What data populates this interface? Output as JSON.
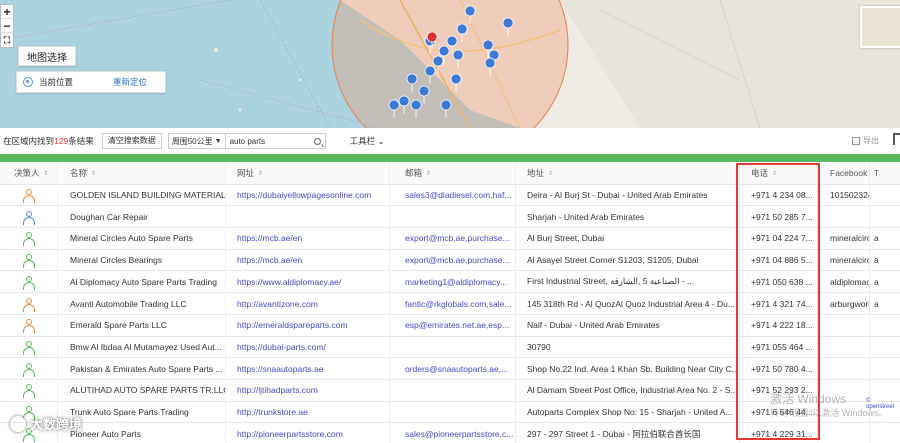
{
  "map": {
    "zoom_in": "+",
    "zoom_out": "−",
    "fullscreen": "⛶",
    "select_label": "地图选择",
    "current_location": "当前位置",
    "relocate": "重新定位"
  },
  "toolbar": {
    "result_prefix": "在区域内找到",
    "result_count": "129",
    "result_suffix": "条结果",
    "clear_button": "清空搜索数据",
    "radius_select": "周围50公里",
    "search_value": "auto parts",
    "tools_label": "工具栏",
    "export_label": "导出"
  },
  "table": {
    "columns": [
      "决策人",
      "名称",
      "网址",
      "邮箱",
      "地址",
      "电话",
      "Facebook",
      "T"
    ],
    "rows": [
      {
        "dm": "orange",
        "name": "GOLDEN ISLAND BUILDING MATERIAL...",
        "url": "https://dubaiyellowpagesonline.com",
        "email": "sales3@diadiesel.com,haf...",
        "address": "Deira - Al Burj St - Dubai - United Arab Emirates",
        "phone": "+971 4 234 08...",
        "facebook": "101502324...",
        "x": ""
      },
      {
        "dm": "blue",
        "name": "Doughan Car Repair",
        "url": "",
        "email": "",
        "address": "Sharjah - United Arab Emirates",
        "phone": "+971 50 285 7...",
        "facebook": "",
        "x": ""
      },
      {
        "dm": "green",
        "name": "Mineral Circles Auto Spare Parts",
        "url": "https://mcb.ae/en",
        "email": "export@mcb.ae,purchase...",
        "address": "Al Burj Street, Dubai",
        "phone": "+971 04 224 7...",
        "facebook": "mineralcircl...",
        "x": "a"
      },
      {
        "dm": "green",
        "name": "Mineral Circles Bearings",
        "url": "https://mcb.ae/en",
        "email": "export@mcb.ae,purchase...",
        "address": "Al Asayel Street Corner S1203, S1205, Dubai",
        "phone": "+971 04 886 5...",
        "facebook": "mineralcircl...",
        "x": "a"
      },
      {
        "dm": "green",
        "name": "Al Diplomacy Auto Spare Parts Trading",
        "url": "https://www.aldiplomacy.ae/",
        "email": "marketing1@aldiplomacy...",
        "address": "First Industrial Street, الصناعية 5 ,الشارقة - ...",
        "phone": "+971 050 638 ...",
        "facebook": "aldiplomac...",
        "x": "a"
      },
      {
        "dm": "orange",
        "name": "Avanti Automobile Trading LLC",
        "url": "http://avantizone.com",
        "email": "fantic@rkglobals.com,sale...",
        "address": "145 318th Rd - Al QuozAl Quoz Industrial Area 4 - Du...",
        "phone": "+971 4 321 74...",
        "facebook": "arburgworl...",
        "x": "a"
      },
      {
        "dm": "orange",
        "name": "Emerald Spare Parts LLC",
        "url": "http://emeraldspareparts.com",
        "email": "esp@emirates.net.ae,esp...",
        "address": "Naif - Dubai - United Arab Emirates",
        "phone": "+971 4 222 18...",
        "facebook": "",
        "x": ""
      },
      {
        "dm": "green",
        "name": "Bmw Al Ibdaa Al Mutamayez Used Aut...",
        "url": "https://dubai-parts.com/",
        "email": "",
        "address": "30790",
        "phone": "+971 055 464 ...",
        "facebook": "",
        "x": ""
      },
      {
        "dm": "green",
        "name": "Pakistan & Emirates Auto Spare Parts ...",
        "url": "https://snaautoparts.ae",
        "email": "orders@snaautoparts.ae,...",
        "address": "Shop No.22 Ind. Area 1 Khan Sb. Building Near City C...",
        "phone": "+971 50 780 4...",
        "facebook": "",
        "x": ""
      },
      {
        "dm": "green",
        "name": "ALUTIHAD AUTO SPARE PARTS TR.LLC",
        "url": "http://ljtihadparts.com",
        "email": "",
        "address": "Al Damam Street Post Office, Industrial Area No. 2 - S...",
        "phone": "+971 52 293 2...",
        "facebook": "",
        "x": ""
      },
      {
        "dm": "green",
        "name": "Trunk Auto Spare Parts Trading",
        "url": "http://trunkstore.ae",
        "email": "",
        "address": "Autoparts Complex Shop No: 15 - Sharjah - United A...",
        "phone": "+971 6 546 44...",
        "facebook": "",
        "x": ""
      },
      {
        "dm": "green",
        "name": "Pioneer Auto Parts",
        "url": "http://pioneerpartsstore.com",
        "email": "sales@pioneerpartsstore.c...",
        "address": "297 - 297 Street 1 - Dubai - 阿拉伯联合酋长国",
        "phone": "+971 4 229 31...",
        "facebook": "",
        "x": ""
      }
    ]
  },
  "watermark": {
    "line1": "激活 Windows",
    "line2": "转到\"设置\"以激活 Windows。",
    "openstreet": "© openstreet"
  },
  "logo_text": "大数跨境",
  "colors": {
    "accent_green": "#5cb85c",
    "highlight_red": "#e53935",
    "link_purple": "#4a47c9"
  }
}
